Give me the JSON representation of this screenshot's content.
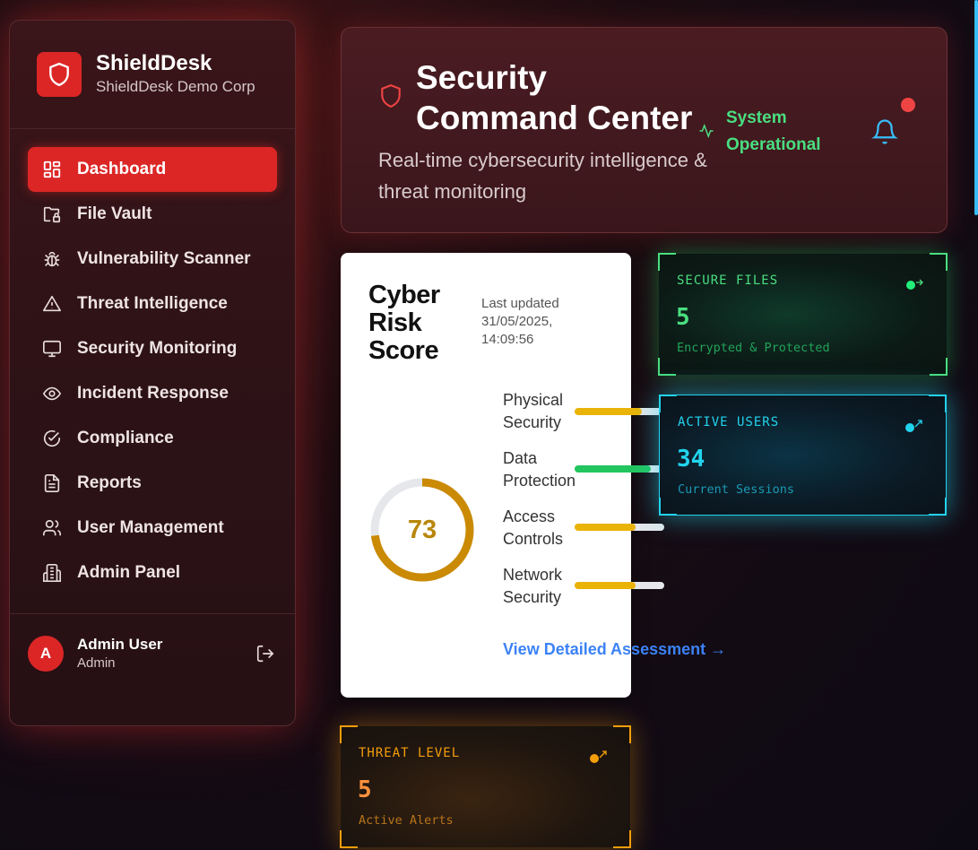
{
  "brand": {
    "name": "ShieldDesk",
    "org": "ShieldDesk Demo Corp",
    "logo_icon": "shield-icon",
    "accent": "#dc2626"
  },
  "sidebar": {
    "items": [
      {
        "label": "Dashboard",
        "icon": "dashboard-icon",
        "active": true
      },
      {
        "label": "File Vault",
        "icon": "folder-lock-icon"
      },
      {
        "label": "Vulnerability Scanner",
        "icon": "bug-icon"
      },
      {
        "label": "Threat Intelligence",
        "icon": "warning-triangle-icon"
      },
      {
        "label": "Security Monitoring",
        "icon": "monitor-icon"
      },
      {
        "label": "Incident Response",
        "icon": "eye-icon"
      },
      {
        "label": "Compliance",
        "icon": "check-circle-icon"
      },
      {
        "label": "Reports",
        "icon": "file-text-icon"
      },
      {
        "label": "User Management",
        "icon": "users-icon"
      },
      {
        "label": "Admin Panel",
        "icon": "building-icon"
      }
    ],
    "user": {
      "initial": "A",
      "name": "Admin User",
      "role": "Admin",
      "logout_icon": "logout-icon"
    }
  },
  "header": {
    "title": "Security Command Center",
    "subtitle": "Real-time cybersecurity intelligence & threat monitoring",
    "status": "System Operational",
    "status_color": "#4ade80",
    "bell_icon": "bell-icon",
    "notification_dot_color": "#ef4444"
  },
  "risk": {
    "title": "Cyber Risk Score",
    "updated": "Last updated 31/05/2025, 14:09:56",
    "score": "73",
    "score_fraction": 0.73,
    "score_color": "#ca8a04",
    "metrics": [
      {
        "label": "Physical Security",
        "fill": 0.75,
        "color": "#eab308"
      },
      {
        "label": "Data Protection",
        "fill": 0.85,
        "color": "#22c55e"
      },
      {
        "label": "Access Controls",
        "fill": 0.68,
        "color": "#eab308"
      },
      {
        "label": "Network Security",
        "fill": 0.68,
        "color": "#eab308"
      }
    ],
    "link": "View Detailed Assessment →"
  },
  "stats": {
    "secure_files": {
      "label": "SECURE FILES",
      "value": "5",
      "sub": "Encrypted & Protected",
      "color": "#4ade80",
      "icon": "arrow-right-dot-icon"
    },
    "active_users": {
      "label": "ACTIVE USERS",
      "value": "34",
      "sub": "Current Sessions",
      "color": "#22d3ee",
      "icon": "arrow-up-right-dot-icon"
    },
    "threat_level": {
      "label": "THREAT LEVEL",
      "value": "5",
      "sub": "Active Alerts",
      "color": "#f59e0b",
      "icon": "arrow-up-right-dot-icon"
    }
  }
}
